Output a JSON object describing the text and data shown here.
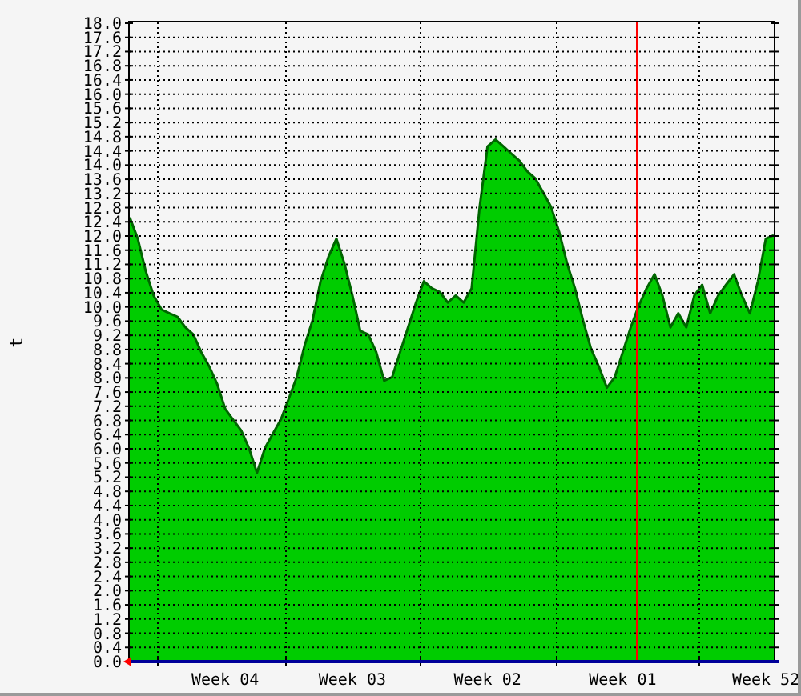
{
  "chart_data": {
    "type": "area",
    "ylabel": "t",
    "grid": true,
    "ylim": [
      0,
      18
    ],
    "categories": [
      null,
      null,
      null,
      null,
      null,
      null,
      null,
      null,
      null,
      null,
      null,
      null,
      "Week 04",
      null,
      null,
      null,
      null,
      null,
      null,
      null,
      null,
      null,
      null,
      null,
      null,
      null,
      null,
      null,
      "Week 03",
      null,
      null,
      null,
      null,
      null,
      null,
      null,
      null,
      null,
      null,
      null,
      null,
      null,
      null,
      null,
      null,
      "Week 02",
      null,
      null,
      null,
      null,
      null,
      null,
      null,
      null,
      null,
      null,
      null,
      null,
      null,
      null,
      null,
      null,
      "Week 01",
      null,
      null,
      null,
      null,
      null,
      null,
      null,
      null,
      null,
      null,
      null,
      null,
      null,
      null,
      null,
      null,
      null,
      "Week 52",
      null
    ],
    "series": [
      {
        "color": "#00cc00",
        "values": [
          12.5,
          11.9,
          11.0,
          10.3,
          9.9,
          9.8,
          9.7,
          9.4,
          9.2,
          8.7,
          8.3,
          7.8,
          7.1,
          6.8,
          6.5,
          6.0,
          5.3,
          6.0,
          6.4,
          6.8,
          7.4,
          8.0,
          8.9,
          9.6,
          10.7,
          11.4,
          11.9,
          11.2,
          10.3,
          9.3,
          9.2,
          8.7,
          7.9,
          8.0,
          8.7,
          9.4,
          10.1,
          10.7,
          10.5,
          10.4,
          10.1,
          10.3,
          10.1,
          10.5,
          12.8,
          14.5,
          14.7,
          14.5,
          14.3,
          14.1,
          13.8,
          13.6,
          13.2,
          12.8,
          12.1,
          11.2,
          10.5,
          9.6,
          8.8,
          8.3,
          7.7,
          8.0,
          8.7,
          9.4,
          10.0,
          10.5,
          10.9,
          10.3,
          9.4,
          9.8,
          9.4,
          10.3,
          10.6,
          9.8,
          10.3,
          10.6,
          10.9,
          10.3,
          9.8,
          10.7,
          11.9,
          12.0
        ]
      }
    ],
    "yticks": [
      {
        "value": 0,
        "label": "0.0"
      },
      {
        "value": 0.4,
        "label": "0.4"
      },
      {
        "value": 0.8,
        "label": "0.8"
      },
      {
        "value": 1.2,
        "label": "1.2"
      },
      {
        "value": 1.6,
        "label": "1.6"
      },
      {
        "value": 2.0,
        "label": "2.0"
      },
      {
        "value": 2.4,
        "label": "2.4"
      },
      {
        "value": 2.8,
        "label": "2.8"
      },
      {
        "value": 3.2,
        "label": "3.2"
      },
      {
        "value": 3.6,
        "label": "3.6"
      },
      {
        "value": 4.0,
        "label": "4.0"
      },
      {
        "value": 4.4,
        "label": "4.4"
      },
      {
        "value": 4.8,
        "label": "4.8"
      },
      {
        "value": 5.2,
        "label": "5.2"
      },
      {
        "value": 5.6,
        "label": "5.6"
      },
      {
        "value": 6.0,
        "label": "6.0"
      },
      {
        "value": 6.4,
        "label": "6.4"
      },
      {
        "value": 6.8,
        "label": "6.8"
      },
      {
        "value": 7.2,
        "label": "7.2"
      },
      {
        "value": 7.6,
        "label": "7.6"
      },
      {
        "value": 8.0,
        "label": "8.0"
      },
      {
        "value": 8.4,
        "label": "8.4"
      },
      {
        "value": 8.8,
        "label": "8.8"
      },
      {
        "value": 9.2,
        "label": "9.2"
      },
      {
        "value": 9.6,
        "label": "9.6"
      },
      {
        "value": 10.0,
        "label": "10.0"
      },
      {
        "value": 10.4,
        "label": "10.4"
      },
      {
        "value": 10.8,
        "label": "10.8"
      },
      {
        "value": 11.2,
        "label": "11.2"
      },
      {
        "value": 11.6,
        "label": "11.6"
      },
      {
        "value": 12.0,
        "label": "12.0"
      },
      {
        "value": 12.4,
        "label": "12.4"
      },
      {
        "value": 12.8,
        "label": "12.8"
      },
      {
        "value": 13.2,
        "label": "13.2"
      },
      {
        "value": 13.6,
        "label": "13.6"
      },
      {
        "value": 14.0,
        "label": "14.0"
      },
      {
        "value": 14.4,
        "label": "14.4"
      },
      {
        "value": 14.8,
        "label": "14.8"
      },
      {
        "value": 15.2,
        "label": "15.2"
      },
      {
        "value": 15.6,
        "label": "15.6"
      },
      {
        "value": 16.0,
        "label": "16.0"
      },
      {
        "value": 16.4,
        "label": "16.4"
      },
      {
        "value": 16.8,
        "label": "16.8"
      },
      {
        "value": 17.2,
        "label": "17.2"
      },
      {
        "value": 17.6,
        "label": "17.6"
      },
      {
        "value": 18.0,
        "label": "18.0"
      }
    ]
  }
}
